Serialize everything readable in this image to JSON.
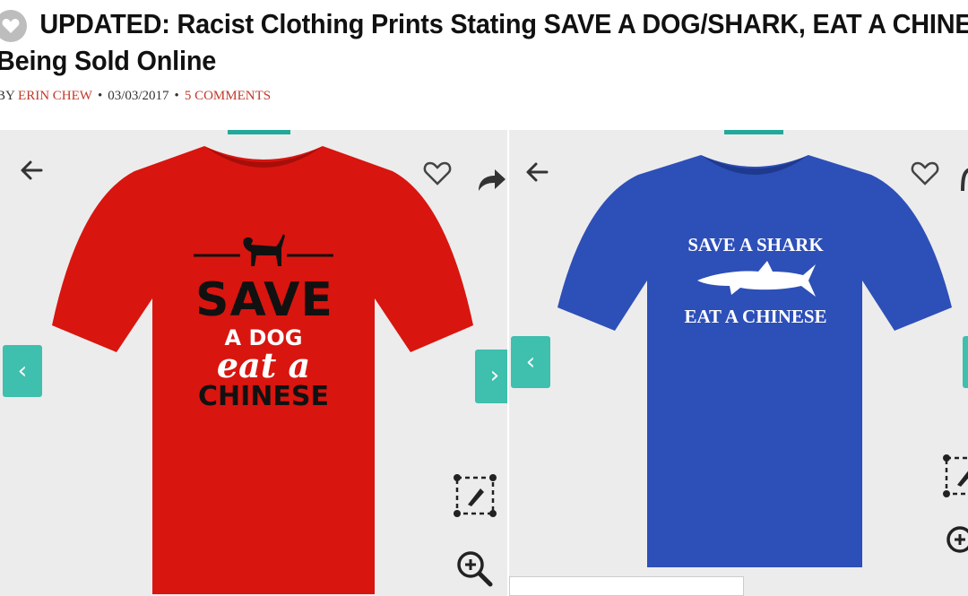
{
  "article": {
    "title_line1": "UPDATED: Racist Clothing Prints Stating SAVE A DOG/SHARK, EAT A CHINESE",
    "title_line2": "Being Sold Online",
    "byline_prefix": "BY",
    "author": "ERIN CHEW",
    "date": "03/03/2017",
    "comments": "5 COMMENTS"
  },
  "products": [
    {
      "shirt_color": "#d9150f",
      "print": {
        "line1": "SAVE",
        "line2": "A DOG",
        "line3": "eat a",
        "line4": "CHINESE"
      }
    },
    {
      "shirt_color": "#2d4fb8",
      "print": {
        "line1": "SAVE A SHARK",
        "line2": "EAT A CHINESE"
      }
    }
  ],
  "icons": {
    "back": "arrow-left-icon",
    "favorite": "heart-icon",
    "share": "share-icon",
    "prev": "chevron-left-icon",
    "next": "chevron-right-icon",
    "designer": "design-tool-icon",
    "zoom": "zoom-in-icon"
  },
  "colors": {
    "accent_teal": "#3fbfae",
    "link_red": "#c0392b",
    "panel_bg": "#ececec"
  }
}
